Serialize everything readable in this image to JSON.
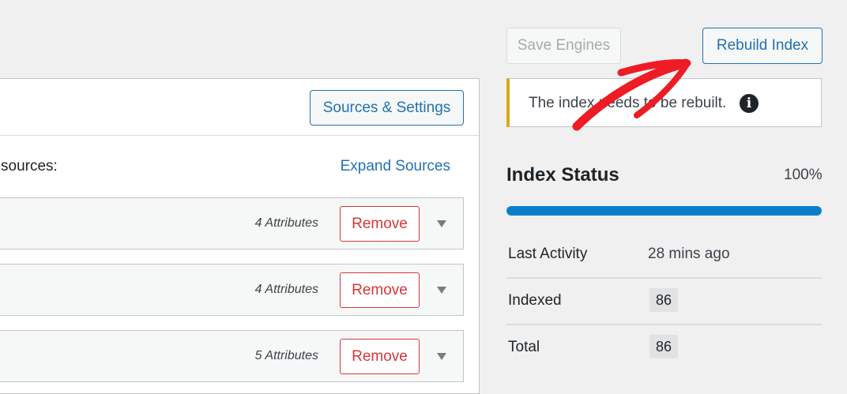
{
  "toolbar": {
    "save_label": "Save Engines",
    "rebuild_label": "Rebuild Index"
  },
  "engine": {
    "sources_settings_label": "Sources & Settings",
    "sources_label": "sources:",
    "expand_label": "Expand Sources",
    "rows": [
      {
        "attributes": "4 Attributes",
        "remove": "Remove"
      },
      {
        "attributes": "4 Attributes",
        "remove": "Remove"
      },
      {
        "attributes": "5 Attributes",
        "remove": "Remove"
      }
    ]
  },
  "notice": {
    "text": "The index needs to be rebuilt.",
    "icon": "info-icon"
  },
  "index_status": {
    "title": "Index Status",
    "percent_label": "100%",
    "progress": 1.0,
    "rows": [
      {
        "label": "Last Activity",
        "value": "28 mins ago"
      },
      {
        "label": "Indexed",
        "value": "86"
      },
      {
        "label": "Total",
        "value": "86"
      }
    ]
  },
  "colors": {
    "accent": "#2271b1",
    "danger": "#d63638",
    "warning": "#dba617",
    "progress": "#0a7fc9",
    "annotation_arrow": "#ee1c25"
  }
}
